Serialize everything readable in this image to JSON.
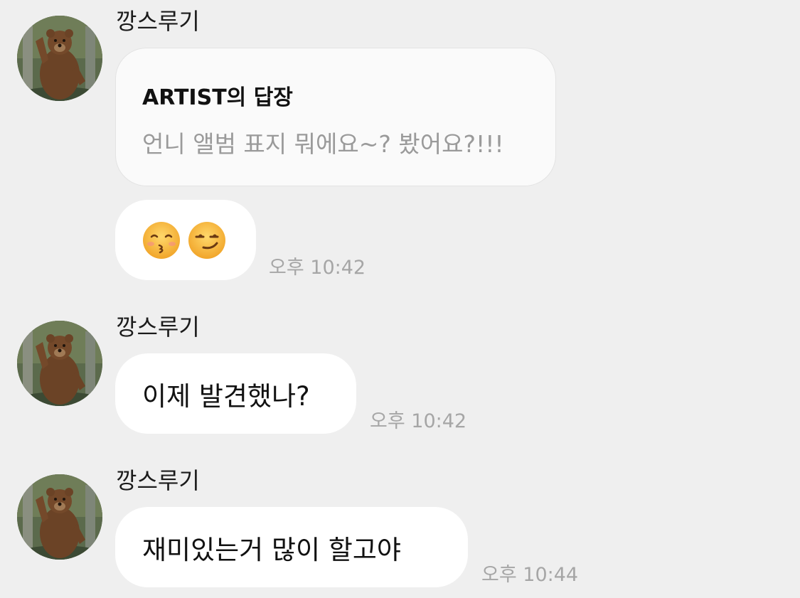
{
  "messages": [
    {
      "sender": "깡스루기",
      "reply": {
        "title": "ARTIST의 답장",
        "body": "언니 앨범 표지 뭐에요~? 봤어요?!!!"
      },
      "emojis": [
        "kissing-face-closed-eyes-emoji",
        "smirking-face-emoji"
      ],
      "time": "오후 10:42"
    },
    {
      "sender": "깡스루기",
      "text": "이제 발견했나?",
      "time": "오후 10:42"
    },
    {
      "sender": "깡스루기",
      "text": "재미있는거 많이 할고야",
      "time": "오후 10:44"
    }
  ],
  "colors": {
    "background": "#efefef",
    "bubble": "#ffffff",
    "reply_card": "#fafafa",
    "timestamp": "#a6a6a6"
  }
}
